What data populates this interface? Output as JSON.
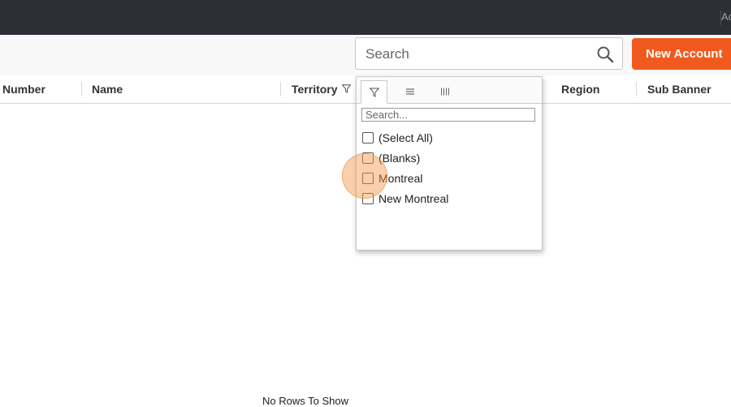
{
  "topbar": {
    "user_label": "Ac"
  },
  "toolbar": {
    "search_placeholder": "Search",
    "new_account_label": "New Account"
  },
  "grid": {
    "columns": [
      "Number",
      "Name",
      "Territory",
      "Region",
      "Sub Banner"
    ],
    "empty_text": "No Rows To Show"
  },
  "filter_panel": {
    "search_placeholder": "Search...",
    "options": [
      "(Select All)",
      "(Blanks)",
      "Montreal",
      "New Montreal"
    ]
  },
  "colors": {
    "topbar": "#2d2f36",
    "accent": "#f15a1e"
  }
}
